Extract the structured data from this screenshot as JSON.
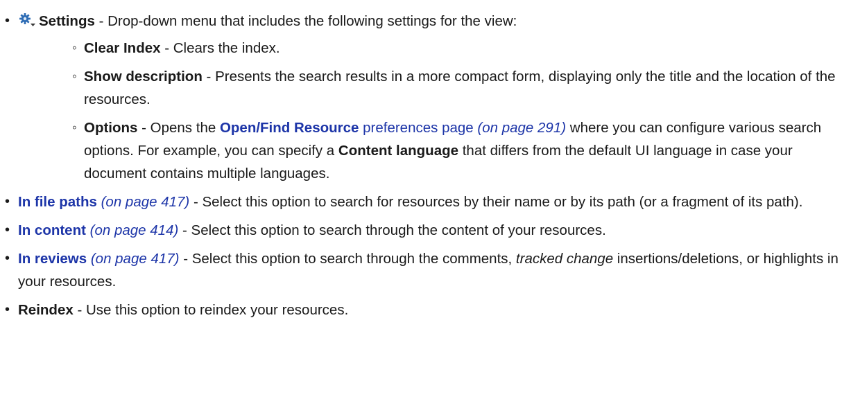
{
  "items": {
    "settings": {
      "term": "Settings",
      "desc": " - Drop-down menu that includes the following settings for the view:",
      "icon": "settings-gear-dropdown-icon",
      "sub": {
        "clear_index": {
          "term": "Clear Index",
          "desc": " - Clears the index."
        },
        "show_description": {
          "term": "Show description",
          "desc": " - Presents the search results in a more compact form, displaying only the title and the location of the resources."
        },
        "options": {
          "term": "Options",
          "desc1": " - Opens the ",
          "link_bold": "Open/Find Resource",
          "link_rest": " preferences page",
          "ref": " (on page 291)",
          "desc2": " where you can configure various search options. For example, you can specify a ",
          "bold2": "Content language",
          "desc3": " that differs from the default UI language in case your document contains multiple languages."
        }
      }
    },
    "in_file_paths": {
      "link": "In file paths",
      "ref": " (on page 417)",
      "desc": " - Select this option to search for resources by their name or by its path (or a fragment of its path)."
    },
    "in_content": {
      "link": "In content",
      "ref": " (on page 414)",
      "desc": " - Select this option to search through the content of your resources."
    },
    "in_reviews": {
      "link": "In reviews",
      "ref": " (on page 417)",
      "desc1": " - Select this option to search through the comments, ",
      "italic": "tracked change",
      "desc2": " insertions/deletions, or highlights in your resources."
    },
    "reindex": {
      "term": "Reindex",
      "desc": " - Use this option to reindex your resources."
    }
  },
  "colors": {
    "link": "#1d35a8",
    "text": "#1a1a1a",
    "icon": "#2f6db5"
  }
}
